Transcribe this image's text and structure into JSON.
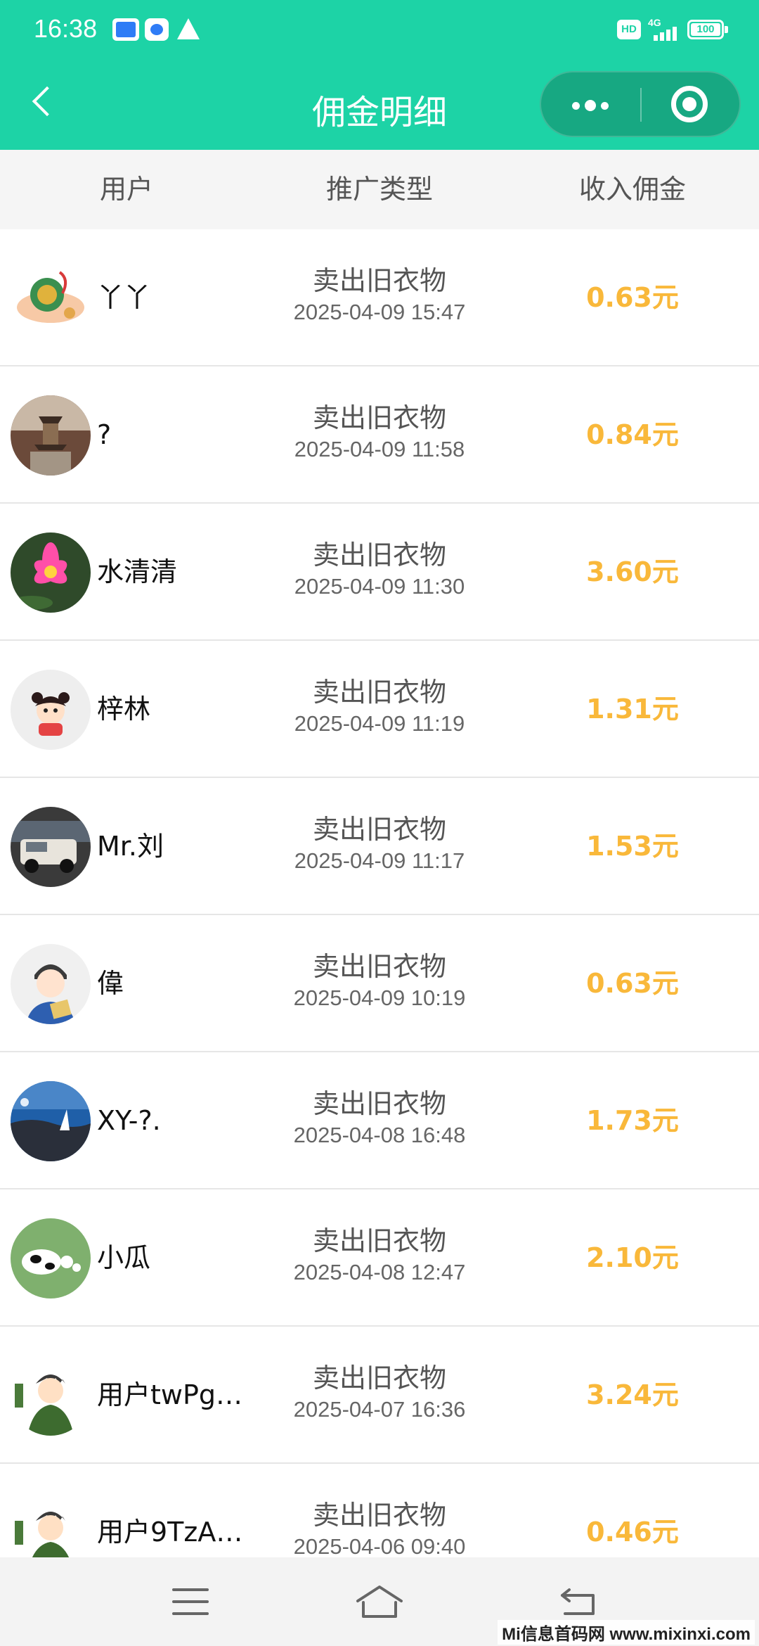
{
  "status_bar": {
    "time": "16:38",
    "hd_label": "HD",
    "network": "4G",
    "battery": "100"
  },
  "nav": {
    "title": "佣金明细"
  },
  "columns": {
    "user": "用户",
    "type": "推广类型",
    "income": "收入佣金"
  },
  "colors": {
    "brand": "#1dd3a6",
    "amount": "#f9b83a"
  },
  "rows": [
    {
      "name": "丫丫",
      "type": "卖出旧衣物",
      "time": "2025-04-09 15:47",
      "amount": "0.63元",
      "avatar": "ornament-avatar"
    },
    {
      "name": "?",
      "type": "卖出旧衣物",
      "time": "2025-04-09 11:58",
      "amount": "0.84元",
      "avatar": "pagoda-avatar"
    },
    {
      "name": "水清清",
      "type": "卖出旧衣物",
      "time": "2025-04-09 11:30",
      "amount": "3.60元",
      "avatar": "lotus-avatar"
    },
    {
      "name": "梓林",
      "type": "卖出旧衣物",
      "time": "2025-04-09 11:19",
      "amount": "1.31元",
      "avatar": "cartoon-girl-avatar"
    },
    {
      "name": "Mr.刘",
      "type": "卖出旧衣物",
      "time": "2025-04-09 11:17",
      "amount": "1.53元",
      "avatar": "car-avatar"
    },
    {
      "name": "偉",
      "type": "卖出旧衣物",
      "time": "2025-04-09 10:19",
      "amount": "0.63元",
      "avatar": "cartoon-boy-avatar"
    },
    {
      "name": "XY-?.",
      "type": "卖出旧衣物",
      "time": "2025-04-08 16:48",
      "amount": "1.73元",
      "avatar": "seaside-avatar"
    },
    {
      "name": "小瓜",
      "type": "卖出旧衣物",
      "time": "2025-04-08 12:47",
      "amount": "2.10元",
      "avatar": "cow-avatar"
    },
    {
      "name": "用户twPg…",
      "type": "卖出旧衣物",
      "time": "2025-04-07 16:36",
      "amount": "3.24元",
      "avatar": "warrior-avatar"
    },
    {
      "name": "用户9TzA…",
      "type": "卖出旧衣物",
      "time": "2025-04-06 09:40",
      "amount": "0.46元",
      "avatar": "warrior-avatar"
    }
  ],
  "watermark": "Mi信息首码网 www.mixinxi.com"
}
